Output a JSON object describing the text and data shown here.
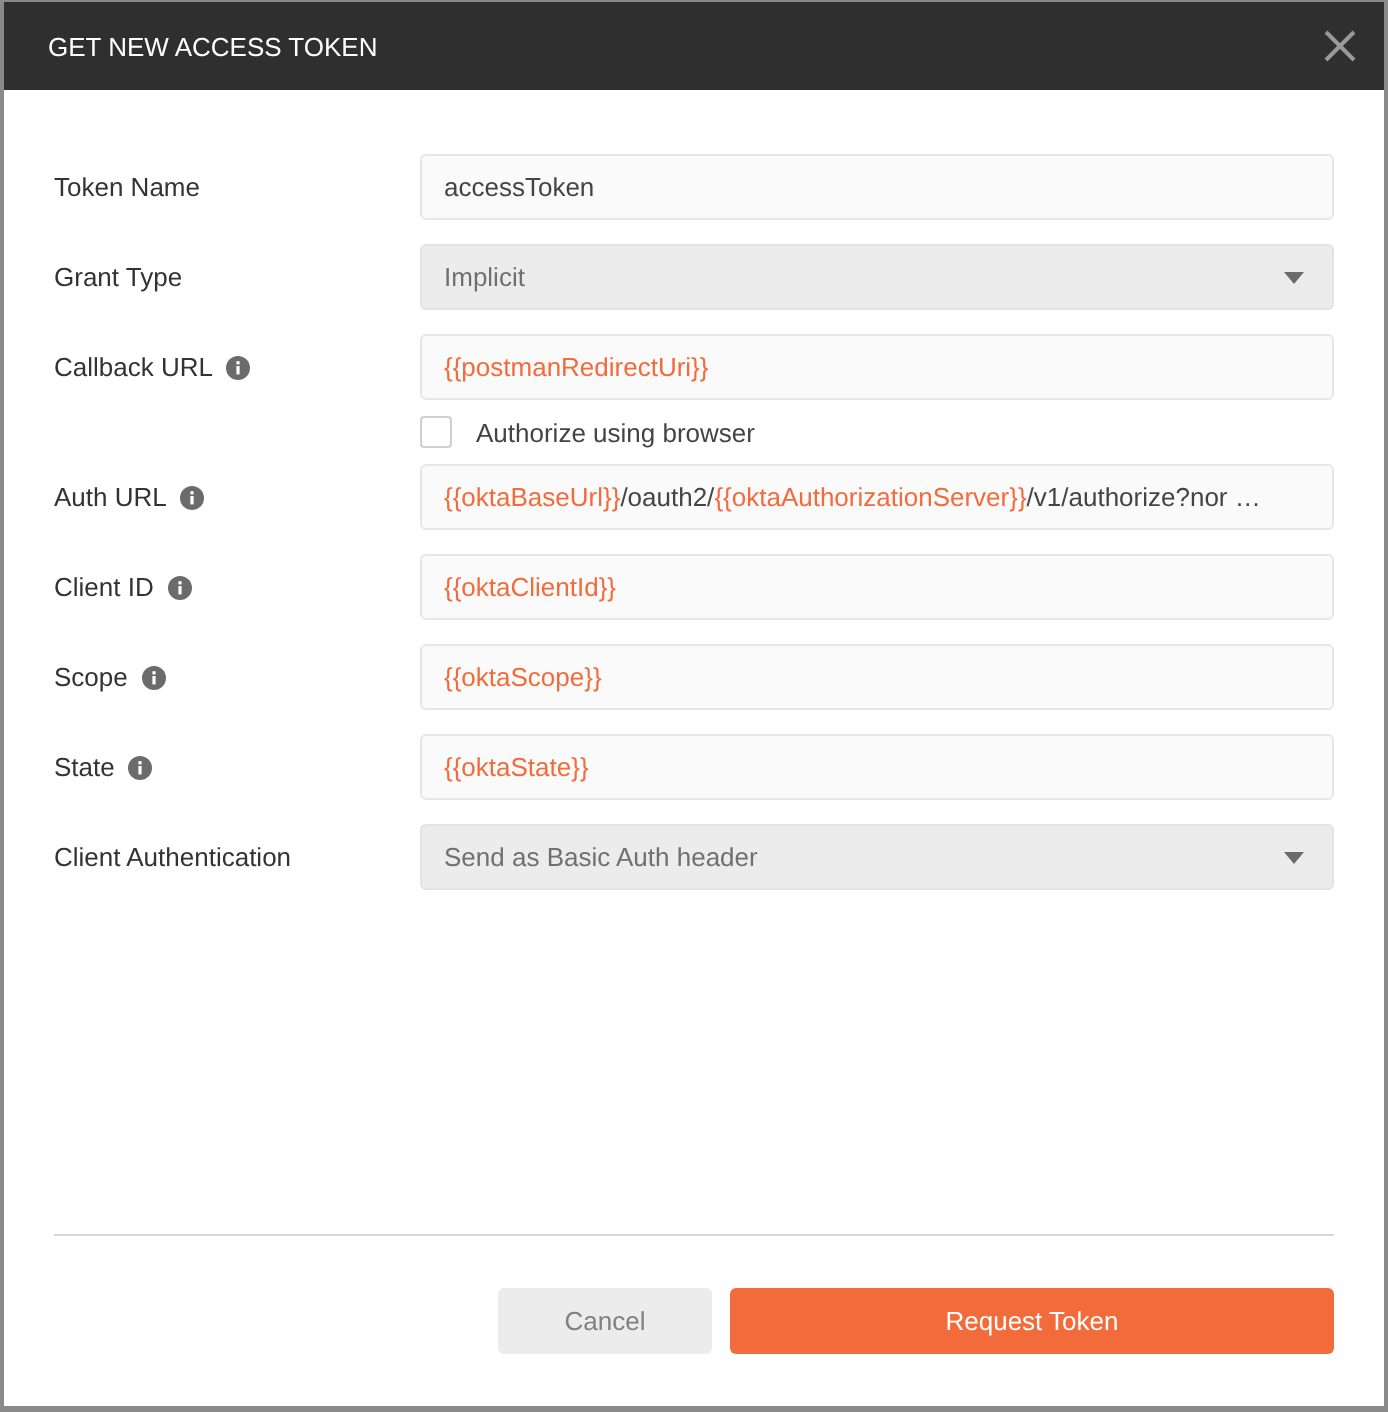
{
  "dialog": {
    "title": "GET NEW ACCESS TOKEN"
  },
  "fields": [
    {
      "kind": "text",
      "label": "Token Name",
      "info": false,
      "value": [
        {
          "text": "accessToken",
          "variable": false
        }
      ]
    },
    {
      "kind": "select",
      "label": "Grant Type",
      "info": false,
      "value": [
        {
          "text": "Implicit",
          "variable": false
        }
      ]
    },
    {
      "kind": "text",
      "label": "Callback URL",
      "info": true,
      "value": [
        {
          "text": "{{postmanRedirectUri}}",
          "variable": true
        }
      ]
    },
    {
      "kind": "checkbox",
      "label": "Authorize using browser",
      "checked": false
    },
    {
      "kind": "text",
      "label": "Auth URL",
      "info": true,
      "value": [
        {
          "text": "{{oktaBaseUrl}}",
          "variable": true
        },
        {
          "text": "/oauth2/",
          "variable": false
        },
        {
          "text": "{{oktaAuthorizationServer}}",
          "variable": true
        },
        {
          "text": "/v1/authorize?nor …",
          "variable": false
        }
      ]
    },
    {
      "kind": "text",
      "label": "Client ID",
      "info": true,
      "value": [
        {
          "text": "{{oktaClientId}}",
          "variable": true
        }
      ]
    },
    {
      "kind": "text",
      "label": "Scope",
      "info": true,
      "value": [
        {
          "text": "{{oktaScope}}",
          "variable": true
        }
      ]
    },
    {
      "kind": "text",
      "label": "State",
      "info": true,
      "value": [
        {
          "text": "{{oktaState}}",
          "variable": true
        }
      ]
    },
    {
      "kind": "select",
      "label": "Client Authentication",
      "info": false,
      "value": [
        {
          "text": "Send as Basic Auth header",
          "variable": false
        }
      ]
    }
  ],
  "buttons": [
    {
      "label": "Cancel",
      "kind": "secondary"
    },
    {
      "label": "Request Token",
      "kind": "primary"
    }
  ]
}
